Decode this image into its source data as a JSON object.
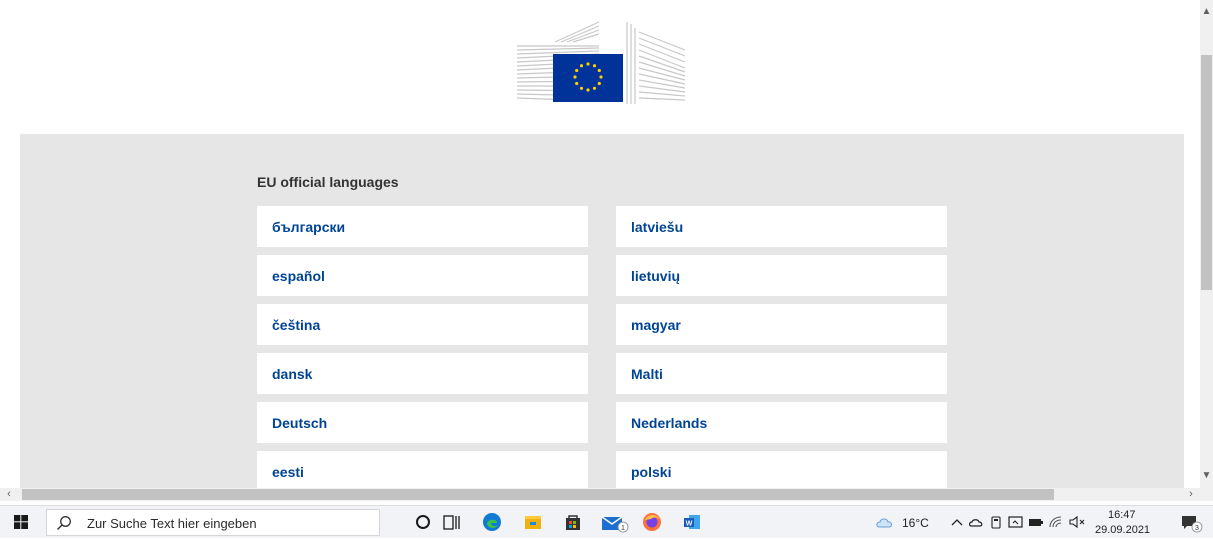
{
  "page": {
    "heading": "EU official languages",
    "languages_left": [
      "български",
      "español",
      "čeština",
      "dansk",
      "Deutsch",
      "eesti"
    ],
    "languages_right": [
      "latviešu",
      "lietuvių",
      "magyar",
      "Malti",
      "Nederlands",
      "polski"
    ]
  },
  "colors": {
    "link": "#004494",
    "panel": "#e6e6e6",
    "eu_blue": "#003399",
    "eu_star": "#ffcc00"
  },
  "taskbar": {
    "search_placeholder": "Zur Suche Text hier eingeben",
    "weather": "16°C",
    "time": "16:47",
    "date": "29.09.2021",
    "mail_badge": "1",
    "notification_badge": "3",
    "icons": [
      "windows-start-icon",
      "search-icon",
      "cortana-icon",
      "task-view-icon",
      "edge-icon",
      "file-explorer-icon",
      "store-icon",
      "mail-icon",
      "firefox-icon",
      "word-icon",
      "weather-icon",
      "chevron-up-icon",
      "onedrive-icon",
      "usb-icon",
      "meet-icon",
      "battery-icon",
      "wifi-icon",
      "volume-icon",
      "notification-icon"
    ]
  }
}
